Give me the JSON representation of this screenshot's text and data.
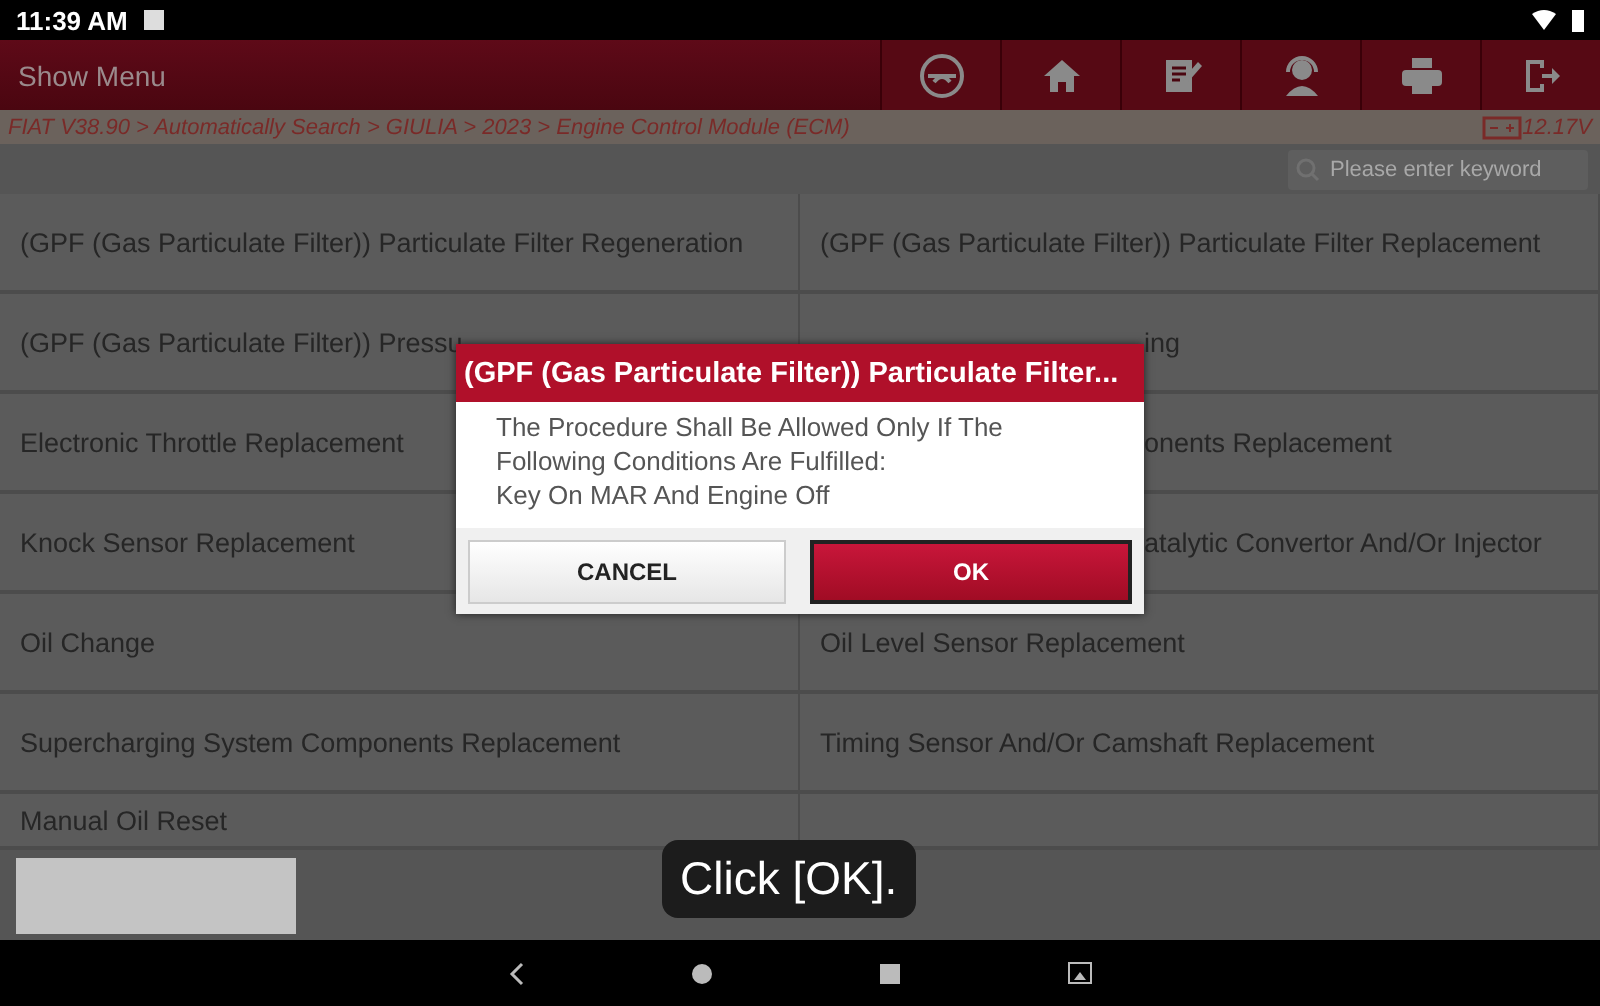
{
  "status_bar": {
    "time": "11:39 AM"
  },
  "header": {
    "title": "Show Menu"
  },
  "breadcrumb": {
    "path": "FIAT V38.90 > Automatically Search > GIULIA > 2023 > Engine Control Module (ECM)",
    "voltage": "12.17V"
  },
  "search": {
    "placeholder": "Please enter keyword"
  },
  "menu_rows": [
    {
      "left": {
        "text": "(GPF (Gas Particulate Filter)) Particulate Filter Regeneration",
        "kind": "full"
      },
      "right": {
        "text": "(GPF (Gas Particulate Filter)) Particulate Filter Replacement",
        "kind": "full"
      }
    },
    {
      "left": {
        "text": "(GPF (Gas Particulate Filter)) Pressu",
        "kind": "full"
      },
      "right": {
        "text": "ing",
        "kind": "covered"
      }
    },
    {
      "left": {
        "text": "Electronic Throttle Replacement",
        "kind": "full"
      },
      "right": {
        "text": "onents Replacement",
        "kind": "covered"
      }
    },
    {
      "left": {
        "text": "Knock Sensor Replacement",
        "kind": "full"
      },
      "right": {
        "text": "atalytic Convertor And/Or Injector",
        "kind": "covered"
      }
    },
    {
      "left": {
        "text": "Oil Change",
        "kind": "full"
      },
      "right": {
        "text": "Oil Level Sensor Replacement",
        "kind": "full"
      }
    },
    {
      "left": {
        "text": "Supercharging System Components Replacement",
        "kind": "full"
      },
      "right": {
        "text": "Timing Sensor And/Or Camshaft Replacement",
        "kind": "full"
      }
    },
    {
      "left": {
        "text": "Manual Oil Reset",
        "kind": "full"
      }
    }
  ],
  "dialog": {
    "title": "(GPF (Gas Particulate Filter)) Particulate Filter...",
    "lines": [
      "The Procedure Shall Be Allowed Only If The",
      "Following Conditions Are Fulfilled:",
      "Key On MAR And Engine Off"
    ],
    "buttons": [
      {
        "label": "CANCEL",
        "kind": "secondary"
      },
      {
        "label": "OK",
        "kind": "primary"
      }
    ]
  },
  "caption": "Click [OK]."
}
